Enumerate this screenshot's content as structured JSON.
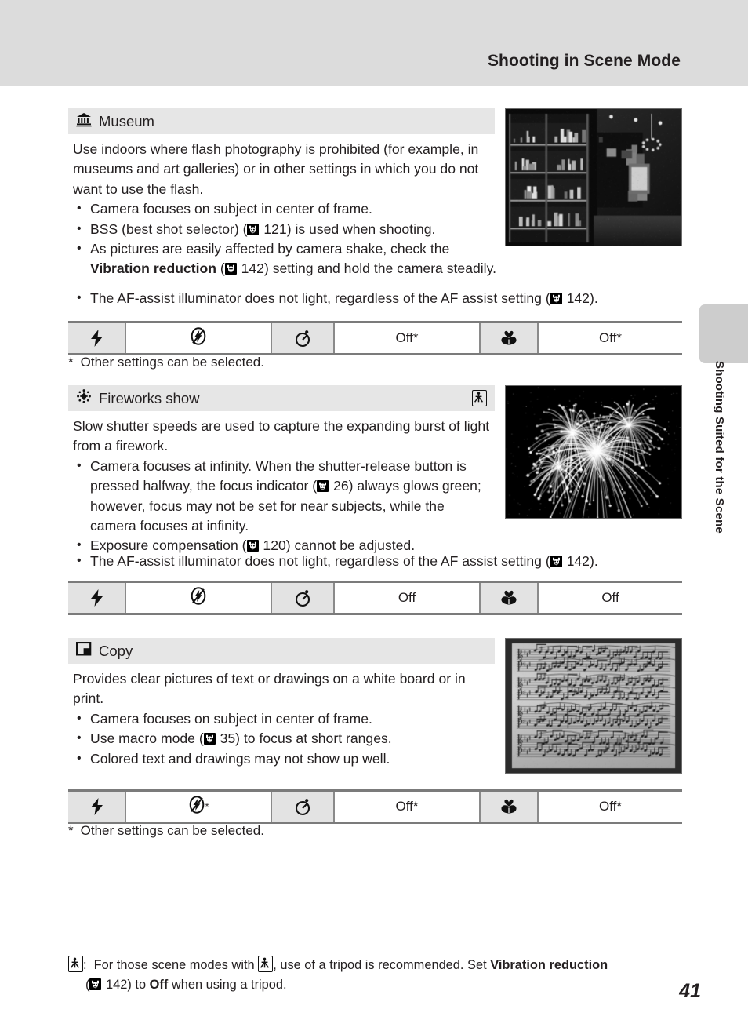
{
  "header": {
    "title": "Shooting in Scene Mode"
  },
  "side_tab": {
    "label": "Shooting Suited for the Scene"
  },
  "page_number": "41",
  "sections": [
    {
      "id": "museum",
      "icon": "museum-icon",
      "title": "Museum",
      "tripod": false,
      "intro": "Use indoors where flash photography is prohibited (for example, in museums and art galleries) or in other settings in which you do not want to use the flash.",
      "bullets": [
        "Camera focuses on subject in center of frame.",
        "BSS (best shot selector) ( 121) is used when shooting.",
        "As pictures are easily affected by camera shake, check the Vibration reduction ( 142) setting and hold the camera steadily.",
        "The AF-assist illuminator does not light, regardless of the AF assist setting ( 142)."
      ],
      "settings": [
        {
          "name": "flash",
          "icon": "flash-icon",
          "value_icon": "flash-off-icon",
          "value": "",
          "value_star": false
        },
        {
          "name": "self-timer",
          "icon": "self-timer-icon",
          "value": "Off*",
          "value_star": true
        },
        {
          "name": "macro",
          "icon": "macro-icon",
          "value": "Off*",
          "value_star": true
        }
      ],
      "note": "Other settings can be selected.",
      "note_star": "*",
      "photo": "museum-interior-photo"
    },
    {
      "id": "fireworks",
      "icon": "fireworks-icon",
      "title": "Fireworks show",
      "tripod": true,
      "intro": "Slow shutter speeds are used to capture the expanding burst of light from a firework.",
      "bullets": [
        "Camera focuses at infinity. When the shutter-release button is pressed halfway, the focus indicator ( 26) always glows green; however, focus may not be set for near subjects, while the camera focuses at infinity.",
        "Exposure compensation ( 120) cannot be adjusted.",
        "The AF-assist illuminator does not light, regardless of the AF assist setting ( 142)."
      ],
      "settings": [
        {
          "name": "flash",
          "icon": "flash-icon",
          "value_icon": "flash-off-icon",
          "value": "",
          "value_star": false
        },
        {
          "name": "self-timer",
          "icon": "self-timer-icon",
          "value": "Off",
          "value_star": false
        },
        {
          "name": "macro",
          "icon": "macro-icon",
          "value": "Off",
          "value_star": false
        }
      ],
      "note": "",
      "note_star": "",
      "photo": "fireworks-photo"
    },
    {
      "id": "copy",
      "icon": "copy-icon",
      "title": "Copy",
      "tripod": false,
      "intro": "Provides clear pictures of text or drawings on a white board or in print.",
      "bullets": [
        "Camera focuses on subject in center of frame.",
        "Use macro mode ( 35) to focus at short ranges.",
        "Colored text and drawings may not show up well."
      ],
      "settings": [
        {
          "name": "flash",
          "icon": "flash-icon",
          "value_icon": "flash-off-icon",
          "value": "",
          "value_star": true
        },
        {
          "name": "self-timer",
          "icon": "self-timer-icon",
          "value": "Off*",
          "value_star": true
        },
        {
          "name": "macro",
          "icon": "macro-icon",
          "value": "Off*",
          "value_star": true
        }
      ],
      "note": "Other settings can be selected.",
      "note_star": "*",
      "photo": "sheet-music-photo"
    }
  ],
  "references": {
    "museum_bss_page": "121",
    "museum_vr_page": "142",
    "museum_af_page": "142",
    "fireworks_focus_page": "26",
    "fireworks_exposure_page": "120",
    "fireworks_af_page": "142",
    "copy_macro_page": "35",
    "footnote_vr_page": "142"
  },
  "footnote": {
    "lead": "For those scene modes with",
    "mid": ", use of a tripod is recommended. Set",
    "bold1": "Vibration reduction",
    "page": "142",
    "tail1": ") to",
    "bold2": "Off",
    "tail2": "when using a tripod."
  },
  "colors": {
    "header_band": "#dcdcdc",
    "section_bar": "#e6e6e6",
    "icon_cell": "#e3e3e3",
    "rule": "#7b7b7b",
    "text": "#231f20",
    "side_tab": "#cdcdcd"
  }
}
